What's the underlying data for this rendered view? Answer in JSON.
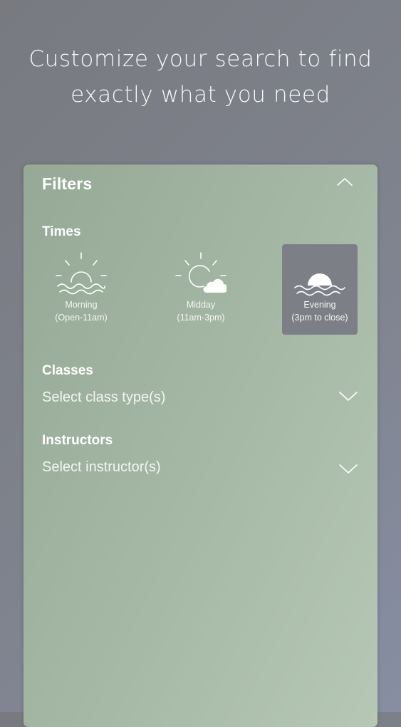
{
  "headline": {
    "line1": "Customize your search to find",
    "line2": "exactly what you need"
  },
  "filters": {
    "title": "Filters",
    "collapse_icon": "chevron-up-icon",
    "times": {
      "label": "Times",
      "options": [
        {
          "name": "Morning",
          "range": "(Open-11am)",
          "icon": "sunrise-icon",
          "selected": false
        },
        {
          "name": "Midday",
          "range": "(11am-3pm)",
          "icon": "sun-cloud-icon",
          "selected": false
        },
        {
          "name": "Evening",
          "range": "(3pm to close)",
          "icon": "sunset-icon",
          "selected": true
        }
      ]
    },
    "classes": {
      "label": "Classes",
      "placeholder": "Select class type(s)",
      "icon": "chevron-down-icon"
    },
    "instructors": {
      "label": "Instructors",
      "placeholder": "Select instructor(s)",
      "icon": "chevron-down-icon"
    }
  },
  "colors": {
    "card_gradient_start": "#96a997",
    "card_gradient_end": "#b6c8b5",
    "selected_time_bg": "#7d7f86",
    "background": "#7f838d"
  }
}
